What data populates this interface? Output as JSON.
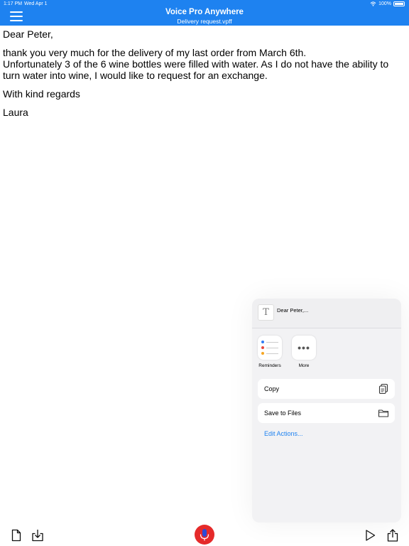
{
  "status": {
    "time": "1:17 PM",
    "date": "Wed Apr 1",
    "battery": "100%"
  },
  "header": {
    "title": "Voice Pro Anywhere",
    "subtitle": "Delivery request.vpff",
    "accent": "#1e82f0"
  },
  "document": {
    "greeting": "Dear Peter,",
    "line1": "thank you very much for the delivery of my last order from March 6th.",
    "line2": "Unfortunately 3 of the 6 wine bottles were filled with water. As I do not have the ability to turn water into wine, I would like to request for an exchange.",
    "closing": "With kind regards",
    "signature": "Laura"
  },
  "share_sheet": {
    "preview_title": "Dear Peter,...",
    "apps": [
      {
        "label": "Reminders",
        "icon": "reminders-icon"
      },
      {
        "label": "More",
        "icon": "more-icon"
      }
    ],
    "actions": [
      {
        "label": "Copy",
        "icon": "copy-icon"
      },
      {
        "label": "Save to Files",
        "icon": "folder-icon"
      }
    ],
    "edit_actions": "Edit Actions..."
  },
  "toolbar": {
    "left_icons": [
      "new-document-icon",
      "import-icon"
    ],
    "center_icon": "microphone-icon",
    "right_icons": [
      "play-icon",
      "share-icon"
    ],
    "mic_color": "#e52a2a"
  }
}
